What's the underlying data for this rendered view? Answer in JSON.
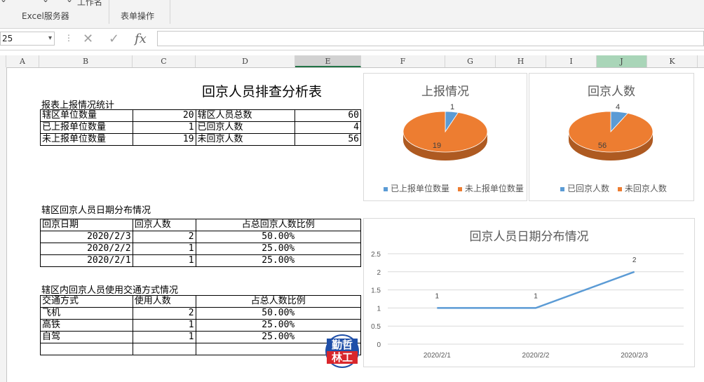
{
  "ribbon": {
    "group1_label": "Excel服务器",
    "group2_label": "表单操作",
    "partial_top_text": "工作名"
  },
  "formula_bar": {
    "name_box": "25",
    "cancel_glyph": "✕",
    "confirm_glyph": "✓",
    "fx_label": "fx",
    "formula_value": ""
  },
  "columns": [
    "A",
    "B",
    "C",
    "D",
    "E",
    "F",
    "G",
    "H",
    "I",
    "J",
    "K"
  ],
  "sheet": {
    "title": "回京人员排查分析表",
    "section1_title": "报表上报情况统计",
    "summary_rows": [
      {
        "label1": "辖区单位数量",
        "value1": "20",
        "label2": "辖区人员总数",
        "value2": "60"
      },
      {
        "label1": "已上报单位数量",
        "value1": "1",
        "label2": "已回京人数",
        "value2": "4"
      },
      {
        "label1": "未上报单位数量",
        "value1": "19",
        "label2": "未回京人数",
        "value2": "56"
      }
    ],
    "section2_title": "辖区回京人员日期分布情况",
    "date_table": {
      "headers": [
        "回京日期",
        "回京人数",
        "占总回京人数比例"
      ],
      "rows": [
        [
          "2020/2/3",
          "2",
          "50.00%"
        ],
        [
          "2020/2/2",
          "1",
          "25.00%"
        ],
        [
          "2020/2/1",
          "1",
          "25.00%"
        ]
      ]
    },
    "section3_title": "辖区内回京人员使用交通方式情况",
    "transport_table": {
      "headers": [
        "交通方式",
        "使用人数",
        "占总人数比例"
      ],
      "rows": [
        [
          "飞机",
          "2",
          "50.00%"
        ],
        [
          "高铁",
          "1",
          "25.00%"
        ],
        [
          "自驾",
          "1",
          "25.00%"
        ],
        [
          "",
          "",
          ""
        ]
      ]
    },
    "stamp": {
      "line1": "勤哲",
      "line2": "林工"
    }
  },
  "colors": {
    "blue": "#5b9bd5",
    "orange": "#ed7d31",
    "excel_green": "#217346"
  },
  "chart_data": [
    {
      "type": "pie",
      "title": "上报情况",
      "labels": [
        "已上报单位数量",
        "未上报单位数量"
      ],
      "values": [
        1,
        19
      ],
      "legend": "bottom"
    },
    {
      "type": "pie",
      "title": "回京人数",
      "labels": [
        "已回京人数",
        "未回京人数"
      ],
      "values": [
        4,
        56
      ],
      "legend": "bottom"
    },
    {
      "type": "line",
      "title": "回京人员日期分布情况",
      "categories": [
        "2020/2/1",
        "2020/2/2",
        "2020/2/3"
      ],
      "values": [
        1,
        1,
        2
      ],
      "yticks": [
        "0",
        "0.5",
        "1",
        "1.5",
        "2",
        "2.5"
      ],
      "ylim": [
        0,
        2.5
      ],
      "grid": true
    }
  ]
}
